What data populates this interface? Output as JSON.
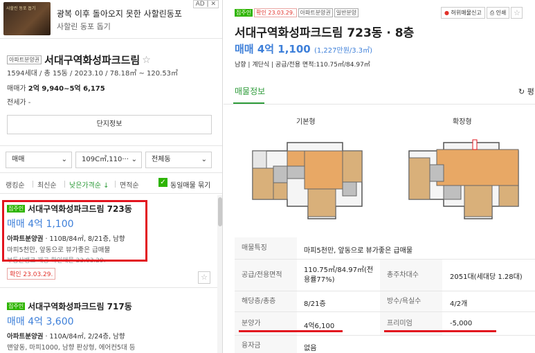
{
  "ad": {
    "badge": "AD | ✕",
    "thumb_text": "사할린 동포 돕기",
    "title": "광복 이후 돌아오지 못한 사할린동포",
    "subtitle": "사할린 동포 돕기"
  },
  "complex": {
    "tag": "아파트분양권",
    "name": "서대구역화성파크드림",
    "star": "☆",
    "summary": "1594세대 / 총 15동 / 2023.10 / 78.18㎡ ~ 120.53㎡",
    "sale_label": "매매가",
    "sale_value": "2억 9,940~5억 6,175",
    "jeonse": "전세가 -",
    "info_button": "단지정보"
  },
  "filters": {
    "trade": "매매",
    "area": "109C㎡,110···",
    "dong": "전체동",
    "chevron": "⌄"
  },
  "sort": {
    "items": [
      "랭킹순",
      "최신순",
      "낮은가격순 ↓",
      "면적순"
    ],
    "same_listing": "동일매물 묶기",
    "check": "✓"
  },
  "listings": [
    {
      "tag": "집주인",
      "title": "서대구역화성파크드림 723동",
      "price": "매매 4억 1,100",
      "type": "아파트분양권",
      "desc": " · 110B/84㎡, 8/21층, 남향",
      "features": "마피5천만, 앞동으로 뷰가좋은 급매물",
      "note": "부동산뱅크 제공 확인매물 23.03.29.",
      "confirm": "확인 23.03.29.",
      "star": "☆"
    },
    {
      "tag": "집주인",
      "title": "서대구역화성파크드림 717동",
      "price": "매매 4억 3,600",
      "type": "아파트분양권",
      "desc": " · 110A/84㎡, 2/24층, 남향",
      "features": "맨앞동, 마피1000, 남향 판상형, 에어컨5대 등"
    }
  ],
  "detail": {
    "tags": [
      "집주인",
      "확인 23.03.29.",
      "아파트분양권",
      "일반분양"
    ],
    "report_button": "허위매물신고",
    "print_button": "인쇄",
    "report_icon": "●",
    "print_icon": "⎙",
    "star": "☆",
    "title": "서대구역화성파크드림 723동 · 8층",
    "price": "매매 4억 1,100",
    "price_unit": "(1,227만원/3.3㎡)",
    "spec": "남향 | 계단식 | 공급/전용 면적:110.75㎡/84.97㎡",
    "tab_active": "매물정보",
    "tab_other": "↻ 평",
    "plan_basic": "기본형",
    "plan_extended": "확장형"
  },
  "table": {
    "rows": [
      {
        "label": "매물특징",
        "value": "마피5천만, 앞동으로 뷰가좋은 급매물"
      },
      {
        "label": "공급/전용면적",
        "value": "110.75㎡/84.97㎡(전용률77%)",
        "label2": "총주차대수",
        "value2": "2051대(세대당 1.28대)"
      },
      {
        "label": "해당층/총층",
        "value": "8/21층",
        "label2": "방수/욕실수",
        "value2": "4/2개"
      },
      {
        "label": "분양가",
        "value": "4억6,100",
        "label2": "프리미엄",
        "value2": "-5,000"
      },
      {
        "label": "융자금",
        "value": "없음"
      }
    ]
  },
  "colors": {
    "accent_green": "#2db400",
    "price_blue": "#3d7fd9",
    "annotation_red": "#e2141e"
  }
}
